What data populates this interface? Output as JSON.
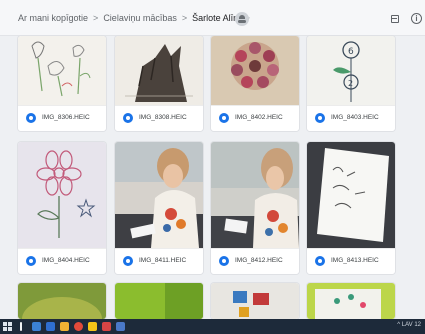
{
  "breadcrumb": {
    "items": [
      "Ar mani kopīgotie",
      "Cielaviņu mācības",
      "Šarlote Alīna"
    ],
    "separator": ">",
    "dropdown_glyph": "▾"
  },
  "toolbar": {
    "shared_icon": "people-icon",
    "list_view_icon": "list-view-icon",
    "info_icon": "info-icon",
    "info_glyph": "i"
  },
  "files": [
    {
      "name": "IMG_8306.HEIC",
      "type_icon": "image-file-icon"
    },
    {
      "name": "IMG_8308.HEIC",
      "type_icon": "image-file-icon"
    },
    {
      "name": "IMG_8402.HEIC",
      "type_icon": "image-file-icon"
    },
    {
      "name": "IMG_8403.HEIC",
      "type_icon": "image-file-icon"
    },
    {
      "name": "IMG_8404.HEIC",
      "type_icon": "image-file-icon"
    },
    {
      "name": "IMG_8411.HEIC",
      "type_icon": "image-file-icon"
    },
    {
      "name": "IMG_8412.HEIC",
      "type_icon": "image-file-icon"
    },
    {
      "name": "IMG_8413.HEIC",
      "type_icon": "image-file-icon"
    }
  ],
  "taskbar": {
    "tray_text": "^  LAV  12"
  },
  "colors": {
    "file_icon": "#1a73e8",
    "taskbar": "#1d2a3a",
    "background": "#eef0f3"
  }
}
